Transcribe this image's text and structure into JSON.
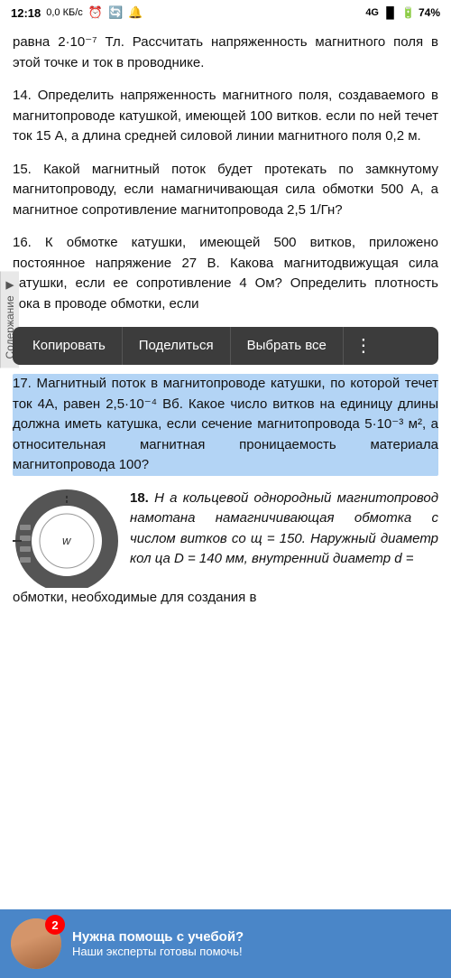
{
  "statusBar": {
    "time": "12:18",
    "dataSpeed": "0,0 КБ/с",
    "battery": "74%",
    "signal": "4G"
  },
  "sidebarLabel": "Содержание",
  "contextMenu": {
    "copy": "Копировать",
    "share": "Поделиться",
    "selectAll": "Выбрать все"
  },
  "problems": {
    "intro": "равна   2·10⁻⁷   Тл.   Рассчитать напряженность магнитного поля в этой точке и ток в проводнике.",
    "p14": "14. Определить напряженность магнитного поля, создаваемого в магнитопроводе катушкой, имеющей 100 витков. если по ней течет ток 15 А, а длина средней силовой линии магнитного поля 0,2 м.",
    "p15": "15. Какой магнитный поток будет протекать по замкнутому магнитопроводу, если намагничивающая сила обмотки 500 А, а магнитное           сопротивление магнитопровода 2,5 1/Гн?",
    "p16": "16. К обмотке катушки, имеющей 500 витков, приложено постоянное напряжение 27 В. Какова магнитодвижущая сила катушки, если ее сопротивление 4 Ом? Определить плотность тока в проводе обмотки, если",
    "p17": "17. Магнитный поток в магнитопроводе катушки, по которой течет ток 4А, равен 2,5·10⁻⁴ Вб. Какое число витков на единицу длины должна иметь катушка, если сечение магнитопровода 5·10⁻³ м², а относительная магнитная проницаемость материала магнитопровода 100?",
    "p18label": "18.",
    "p18text": "Н  а  кольцевой однородный магнитопровод намотана намагничивающая обмотка с числом витков со щ = 150. Наружный диаметр кол ца D = 140 мм, внутренний диаметр d =",
    "p18cont": "обмотки, необходимые для создания в"
  },
  "chatBar": {
    "title": "Нужна помощь с учебой?",
    "subtitle": "Наши эксперты готовы помочь!",
    "badge": "2"
  }
}
